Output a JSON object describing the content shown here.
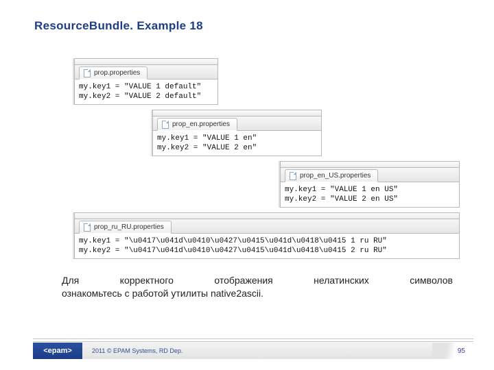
{
  "title": "ResourceBundle. Example 18",
  "windows": {
    "w1": {
      "tab": "prop.properties",
      "line1": "my.key1 = \"VALUE 1 default\"",
      "line2": "my.key2 = \"VALUE 2 default\""
    },
    "w2": {
      "tab": "prop_en.properties",
      "line1": "my.key1 = \"VALUE 1 en\"",
      "line2": "my.key2 = \"VALUE 2 en\""
    },
    "w3": {
      "tab": "prop_en_US.properties",
      "line1": "my.key1 = \"VALUE 1 en US\"",
      "line2": "my.key2 = \"VALUE 2 en US\""
    },
    "w4": {
      "tab": "prop_ru_RU.properties",
      "line1": "my.key1 = \"\\u0417\\u041d\\u0410\\u0427\\u0415\\u041d\\u0418\\u0415 1 ru RU\"",
      "line2": "my.key2 = \"\\u0417\\u041d\\u0410\\u0427\\u0415\\u041d\\u0418\\u0415 2 ru RU\""
    }
  },
  "note": {
    "line1": "Для корректного отображения нелатинских символов",
    "line2": "ознакомьтесь с работой утилиты native2ascii."
  },
  "footer": {
    "brand": "<epam>",
    "copyright": "2011 © EPAM Systems, RD Dep.",
    "page": "95"
  }
}
